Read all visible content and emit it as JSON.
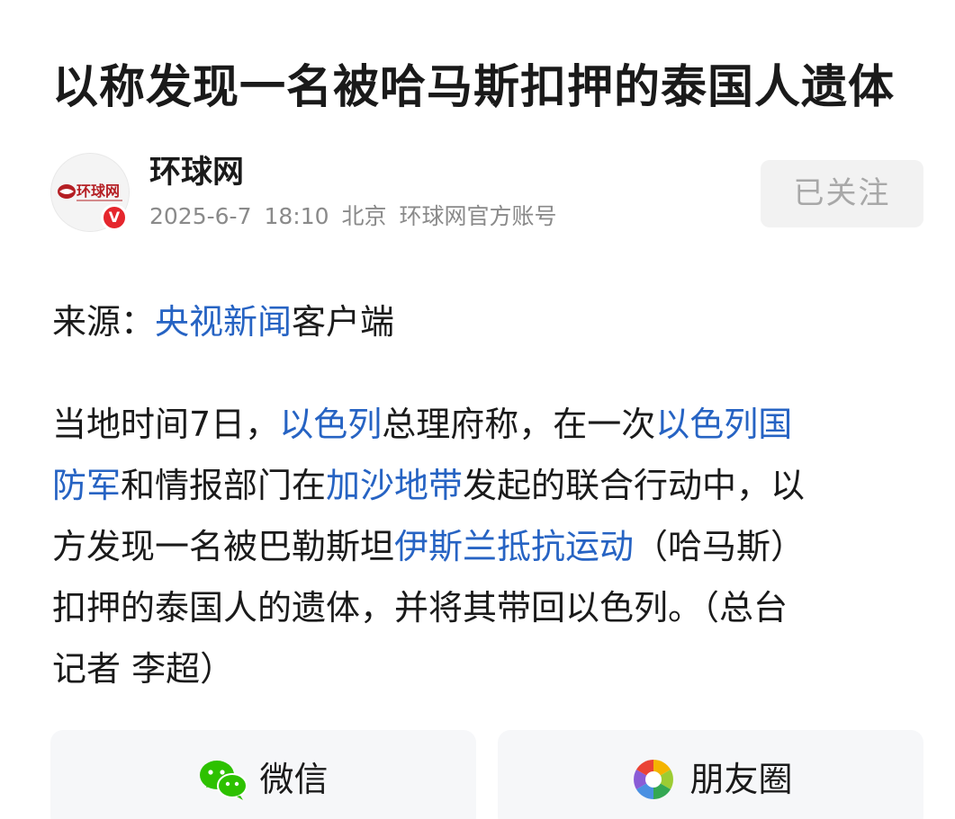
{
  "article": {
    "title": "以称发现一名被哈马斯扣押的泰国人遗体"
  },
  "author": {
    "name": "环球网",
    "avatar_text": "环球网",
    "verified_mark": "V",
    "date": "2025-6-7",
    "time": "18:10",
    "location": "北京",
    "account_type": "环球网官方账号",
    "follow_label": "已关注"
  },
  "source": {
    "prefix": "来源：",
    "link": "央视新闻",
    "suffix": "客户端"
  },
  "body": {
    "l1_a": "当地时间7日，",
    "l1_link1": "以色列",
    "l1_b": "总理府称，在一次",
    "l1_link2": "以色列国",
    "l2_link1": "防军",
    "l2_a": "和情报部门在",
    "l2_link2": "加沙地带",
    "l2_b": "发起的联合行动中，以",
    "l3_a": "方发现一名被巴勒斯坦",
    "l3_link": "伊斯兰抵抗运动",
    "l3_b": "（哈马斯）",
    "l4": "扣押的泰国人的遗体，并将其带回以色列。（总台",
    "l5": "记者 李超）"
  },
  "share": {
    "wechat_label": "微信",
    "moments_label": "朋友圈"
  },
  "colors": {
    "link": "#2663c3",
    "text": "#1a1a1a",
    "meta": "#8a8a8a",
    "badge": "#e5262d",
    "logo_red": "#b51f24",
    "wechat_green": "#2dc100"
  }
}
